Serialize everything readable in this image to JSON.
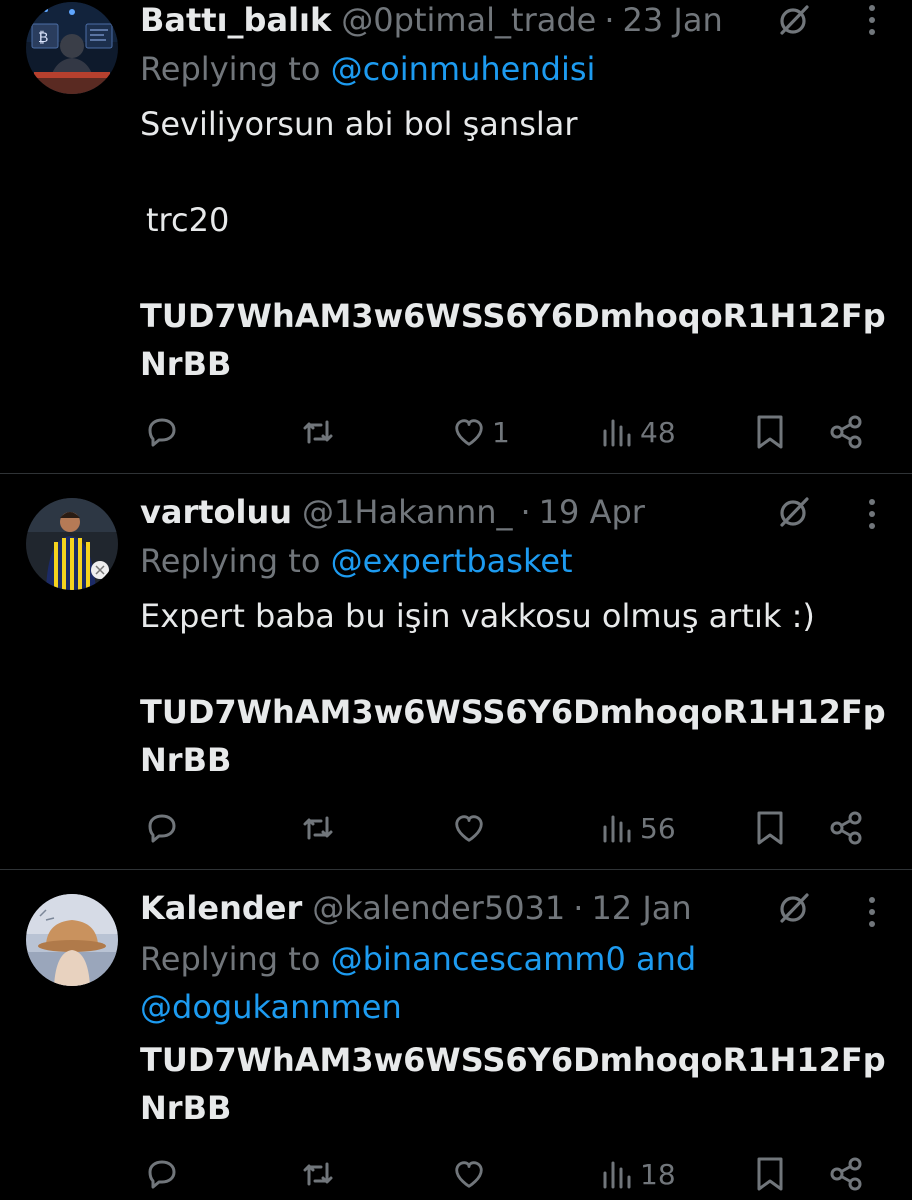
{
  "tweets": [
    {
      "name": "Battı_balık",
      "handle": "@0ptimal_trade",
      "separator": "·",
      "date": "23 Jan",
      "replying_prefix": "Replying to ",
      "replying_to": "@coinmuhendisi",
      "text_line1": "Seviliyorsun abi bol şanslar",
      "text_line2": "trc20",
      "address_line1": "TUD7WhAM3w6WSS6Y6DmhoqoR1H12Fp",
      "address_line2": "NrBB",
      "likes": "1",
      "views": "48",
      "avatar_icon": "hooded-trader-avatar-icon"
    },
    {
      "name": "vartoluu",
      "handle": "@1Hakannn_",
      "separator": "·",
      "date": "19 Apr",
      "replying_prefix": "Replying to ",
      "replying_to": "@expertbasket",
      "text_line1": "Expert baba bu işin vakkosu olmuş artık :)",
      "address_line1": "TUD7WhAM3w6WSS6Y6DmhoqoR1H12Fp",
      "address_line2": "NrBB",
      "likes": "",
      "views": "56",
      "avatar_icon": "football-player-avatar-icon"
    },
    {
      "name": "Kalender",
      "handle": "@kalender5031",
      "separator": "·",
      "date": "12 Jan",
      "replying_prefix": "Replying to ",
      "replying_to": "@binancescamm0",
      "replying_and": " and",
      "replying_to_2": "@dogukannmen",
      "address_line1": "TUD7WhAM3w6WSS6Y6DmhoqoR1H12Fp",
      "address_line2": "NrBB",
      "likes": "",
      "views": "18",
      "avatar_icon": "bucket-hat-avatar-icon"
    }
  ],
  "colors": {
    "background": "#000000",
    "text": "#e7e9ea",
    "muted": "#71767b",
    "mention": "#1d9bf0",
    "divider": "#2f3336"
  }
}
